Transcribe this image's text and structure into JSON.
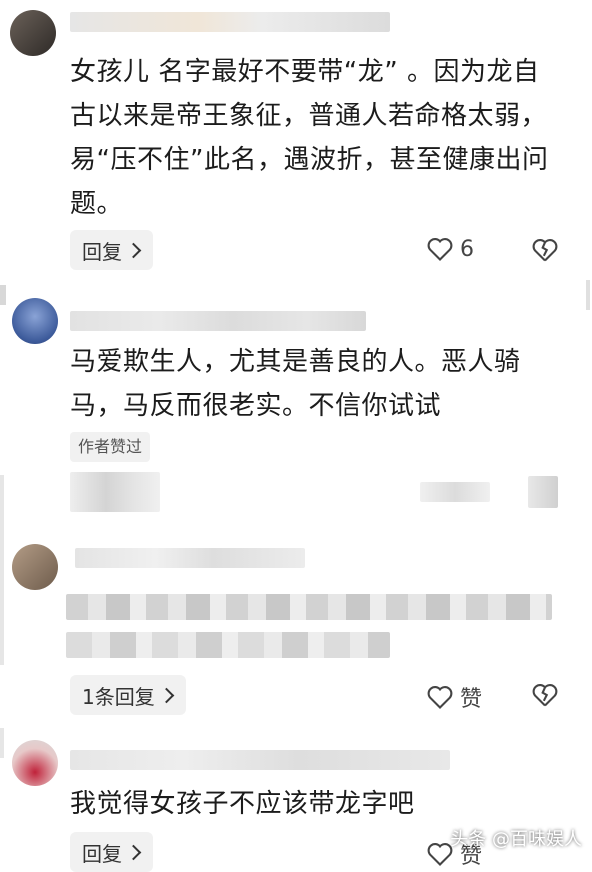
{
  "comments": [
    {
      "text": "女孩儿 名字最好不要带“龙” 。因为龙自古以来是帝王象征，普通人若命格太弱，易“压不住”此名，遇波折，甚至健康出问题。",
      "reply_label": "回复",
      "likes": "6"
    },
    {
      "text": "马爱欺生人，尤其是善良的人。恶人骑马，马反而很老实。不信你试试",
      "author_liked_label": "作者赞过"
    },
    {
      "reply_label": "1条回复",
      "like_label": "赞"
    },
    {
      "text": "我觉得女孩子不应该带龙字吧",
      "reply_label": "回复",
      "like_label": "赞"
    }
  ],
  "watermark": "头条 @百味娱人",
  "colors": {
    "accent_like": "#444444",
    "pill_bg": "#f1f1f1"
  }
}
